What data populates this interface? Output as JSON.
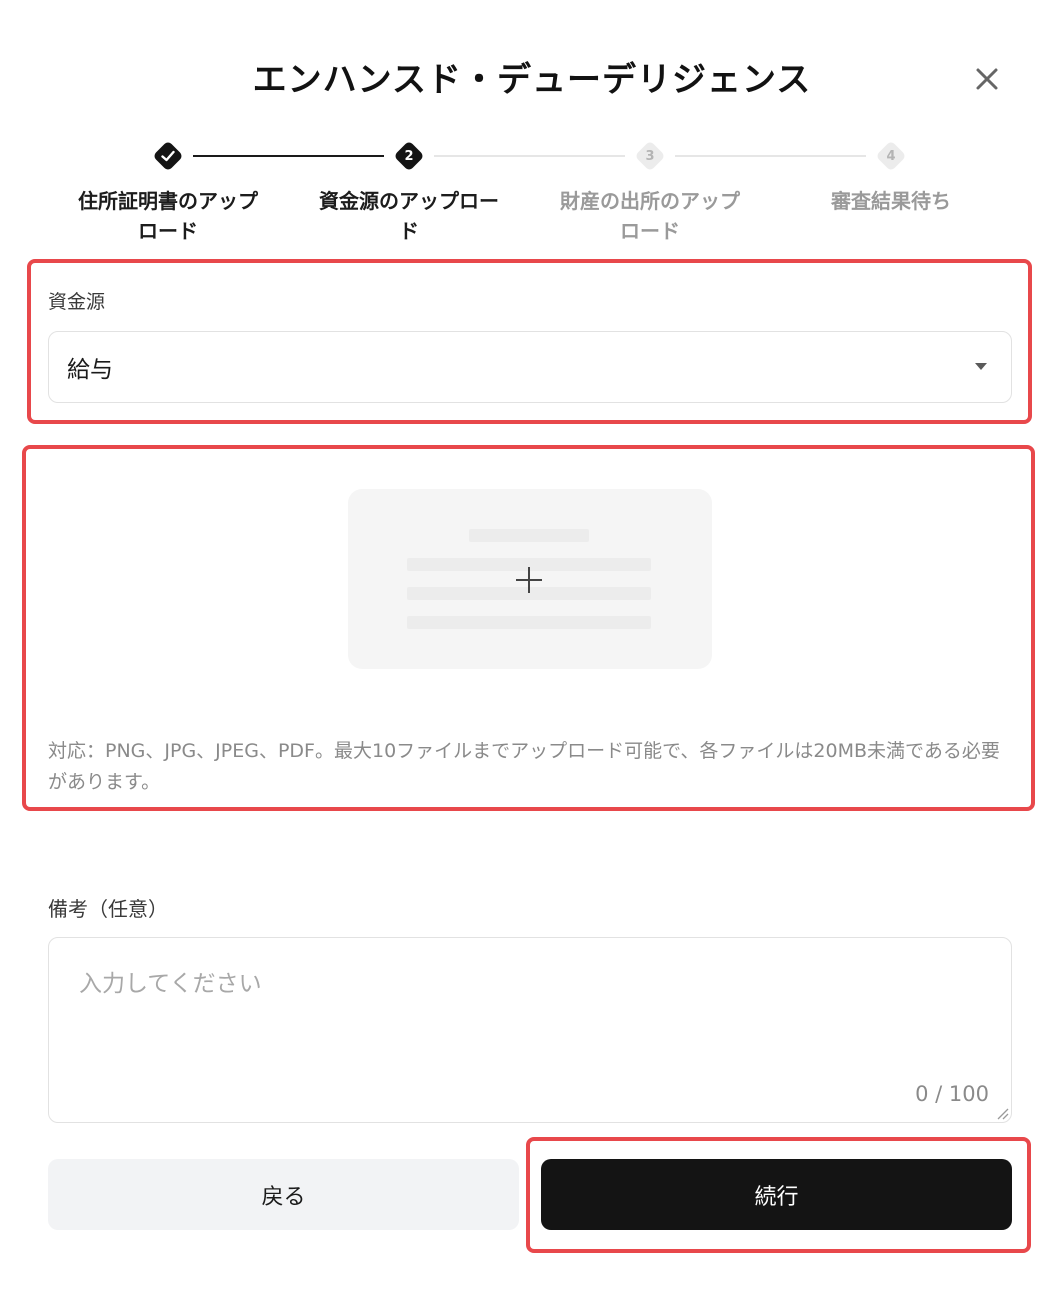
{
  "dialog": {
    "title": "エンハンスド・デューデリジェンス",
    "close_icon": "close-icon"
  },
  "stepper": {
    "steps": [
      {
        "label": "住所証明書のアップロード",
        "status": "completed",
        "number": "1",
        "icon": "check-icon"
      },
      {
        "label": "資金源のアップロード",
        "status": "active",
        "number": "2"
      },
      {
        "label": "財産の出所のアップロード",
        "status": "pending",
        "number": "3"
      },
      {
        "label": "審査結果待ち",
        "status": "pending",
        "number": "4"
      }
    ]
  },
  "source_of_funds": {
    "label": "資金源",
    "selected_value": "給与",
    "icon": "caret-down-icon"
  },
  "upload": {
    "icon": "plus-icon",
    "note": "対応：PNG、JPG、JPEG、PDF。最大10ファイルまでアップロード可能で、各ファイルは20MB未満である必要があります。"
  },
  "remarks": {
    "label": "備考（任意）",
    "placeholder": "入力してください",
    "value": "",
    "counter": "0 / 100"
  },
  "actions": {
    "back_label": "戻る",
    "continue_label": "続行"
  },
  "colors": {
    "highlight": "#e8484b",
    "primary": "#141414",
    "secondary_bg": "#f2f3f5"
  }
}
